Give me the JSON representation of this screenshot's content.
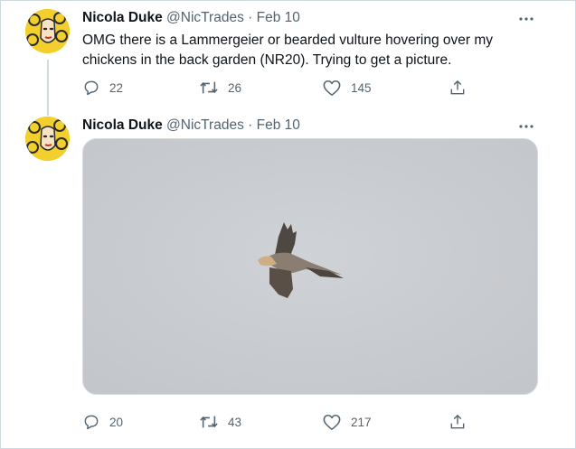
{
  "tweets": [
    {
      "author": {
        "name": "Nicola Duke",
        "handle": "@NicTrades"
      },
      "separator": "·",
      "date": "Feb 10",
      "text_lines": [
        "OMG there is a Lammergeier or bearded vulture hovering over my",
        "chickens in the back garden (NR20).  Trying to get a picture."
      ],
      "actions": {
        "replies": "22",
        "retweets": "26",
        "likes": "145"
      }
    },
    {
      "author": {
        "name": "Nicola Duke",
        "handle": "@NicTrades"
      },
      "separator": "·",
      "date": "Feb 10",
      "media": {
        "icon": "photo-of-bird-in-flight"
      },
      "actions": {
        "replies": "20",
        "retweets": "43",
        "likes": "217"
      }
    }
  ],
  "icons": {
    "more": "more-dots-icon",
    "reply": "reply-bubble-icon",
    "retweet": "retweet-arrows-icon",
    "like": "heart-icon",
    "share": "share-upload-icon"
  },
  "colors": {
    "text": "#0f1419",
    "secondary": "#536471",
    "border": "#cfd9de",
    "sky": "#c9ccd0"
  }
}
